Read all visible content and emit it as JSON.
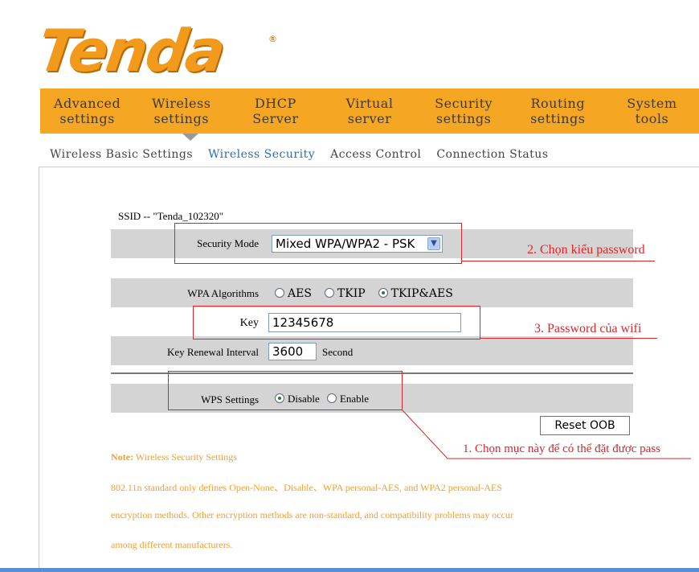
{
  "brand": {
    "logo": "Tenda",
    "registered": "®"
  },
  "nav": {
    "items": [
      {
        "line1": "Advanced",
        "line2": "settings"
      },
      {
        "line1": "Wireless",
        "line2": "settings"
      },
      {
        "line1": "DHCP",
        "line2": "Server"
      },
      {
        "line1": "Virtual",
        "line2": "server"
      },
      {
        "line1": "Security",
        "line2": "settings"
      },
      {
        "line1": "Routing",
        "line2": "settings"
      },
      {
        "line1": "System",
        "line2": "tools"
      }
    ]
  },
  "subnav": {
    "items": [
      "Wireless Basic Settings",
      "Wireless Security",
      "Access Control",
      "Connection Status"
    ],
    "active": "Wireless Security"
  },
  "form": {
    "ssid": "SSID -- \"Tenda_102320\"",
    "security_mode_label": "Security Mode",
    "security_mode_value": "Mixed WPA/WPA2 - PSK",
    "wpa_algorithms_label": "WPA Algorithms",
    "algorithms": [
      "AES",
      "TKIP",
      "TKIP&AES"
    ],
    "algorithm_selected": "TKIP&AES",
    "key_label": "Key",
    "key_value": "12345678",
    "renewal_label": "Key Renewal Interval",
    "renewal_value": "3600",
    "renewal_unit": "Second",
    "wps_label": "WPS Settings",
    "wps_options": [
      "Disable",
      "Enable"
    ],
    "wps_selected": "Disable",
    "reset_button": "Reset OOB"
  },
  "annotations": {
    "a1": "1. Chọn mục này để có thể đặt được pass",
    "a2": "2. Chọn kiểu password",
    "a3": "3. Password của wifi"
  },
  "note": {
    "title": "Note:",
    "title_rest": " Wireless Security Settings",
    "line1": "802.11n standard only defines Open-None、Disable、WPA personal-AES, and WPA2 personal-AES",
    "line2": "encryption methods. Other encryption methods are non-standard, and compatibility problems may occur",
    "line3": "among different manufacturers."
  },
  "colors": {
    "nav_bg": "#f5a623",
    "logo": "#f29a1c",
    "active_link": "#2d6fb7",
    "annotation": "#d9262b",
    "note_text": "#f0a030"
  }
}
